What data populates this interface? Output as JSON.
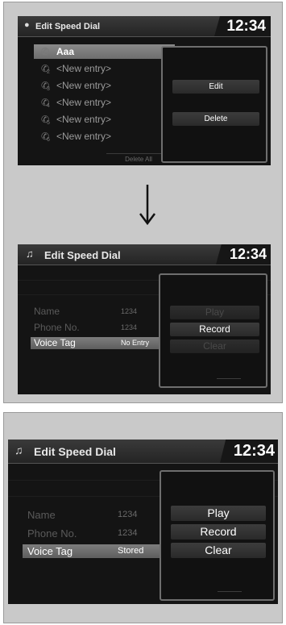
{
  "step1": {
    "title": "Edit Speed Dial",
    "clock": "12:34",
    "entries": [
      {
        "num": "",
        "label": "Aaa"
      },
      {
        "num": "2",
        "label": "<New entry>"
      },
      {
        "num": "3",
        "label": "<New entry>"
      },
      {
        "num": "4",
        "label": "<New entry>"
      },
      {
        "num": "5",
        "label": "<New entry>"
      },
      {
        "num": "6",
        "label": "<New entry>"
      }
    ],
    "delete_all": "Delete All",
    "popup": {
      "edit": "Edit",
      "delete": "Delete"
    }
  },
  "step2": {
    "title": "Edit Speed Dial",
    "clock": "12:34",
    "fields": [
      {
        "label": "Name",
        "value": "1234"
      },
      {
        "label": "Phone No.",
        "value": "1234"
      },
      {
        "label": "Voice Tag",
        "value": "No Entry"
      }
    ],
    "popup": {
      "play": "Play",
      "record": "Record",
      "clear": "Clear"
    }
  },
  "step3": {
    "title": "Edit Speed Dial",
    "clock": "12:34",
    "fields": [
      {
        "label": "Name",
        "value": "1234"
      },
      {
        "label": "Phone No.",
        "value": "1234"
      },
      {
        "label": "Voice Tag",
        "value": "Stored"
      }
    ],
    "popup": {
      "play": "Play",
      "record": "Record",
      "clear": "Clear"
    }
  },
  "icons": {
    "title1": "settings-dot-icon",
    "title2": "music-note-icon",
    "title3": "music-note-icon",
    "entry": "phone-handset-icon",
    "arrow": "down-arrow-icon"
  },
  "colors": {
    "panel_bg": "#c9c9c9",
    "screen_bg": "#141414",
    "selected_row": "#7d7d7d",
    "popup_border": "#6e6e6e"
  }
}
